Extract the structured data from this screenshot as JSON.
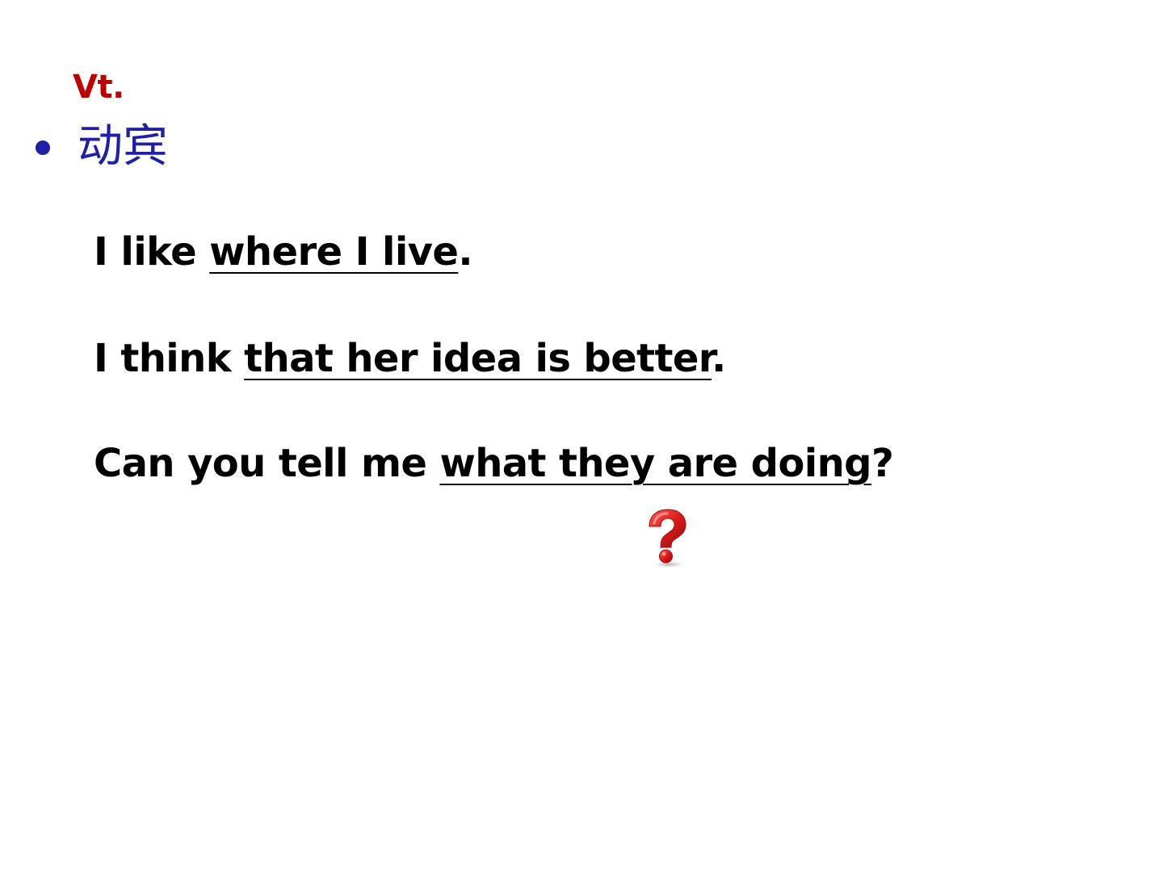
{
  "slide": {
    "tag": {
      "text": "Vt.",
      "color": "#c00000"
    },
    "bullet": {
      "text": "动宾",
      "color": "#1f1fa8",
      "dot_color": "#1f1fa8"
    },
    "sentences": [
      {
        "before": "I like ",
        "clause": "where I live",
        "after": "."
      },
      {
        "before": "I think ",
        "clause": "that her idea is better",
        "after": "."
      },
      {
        "before": "Can you tell me ",
        "clause": "what they are doing",
        "after": "?"
      }
    ],
    "question_icon": {
      "name": "question-mark-icon",
      "color": "#d42020"
    }
  }
}
